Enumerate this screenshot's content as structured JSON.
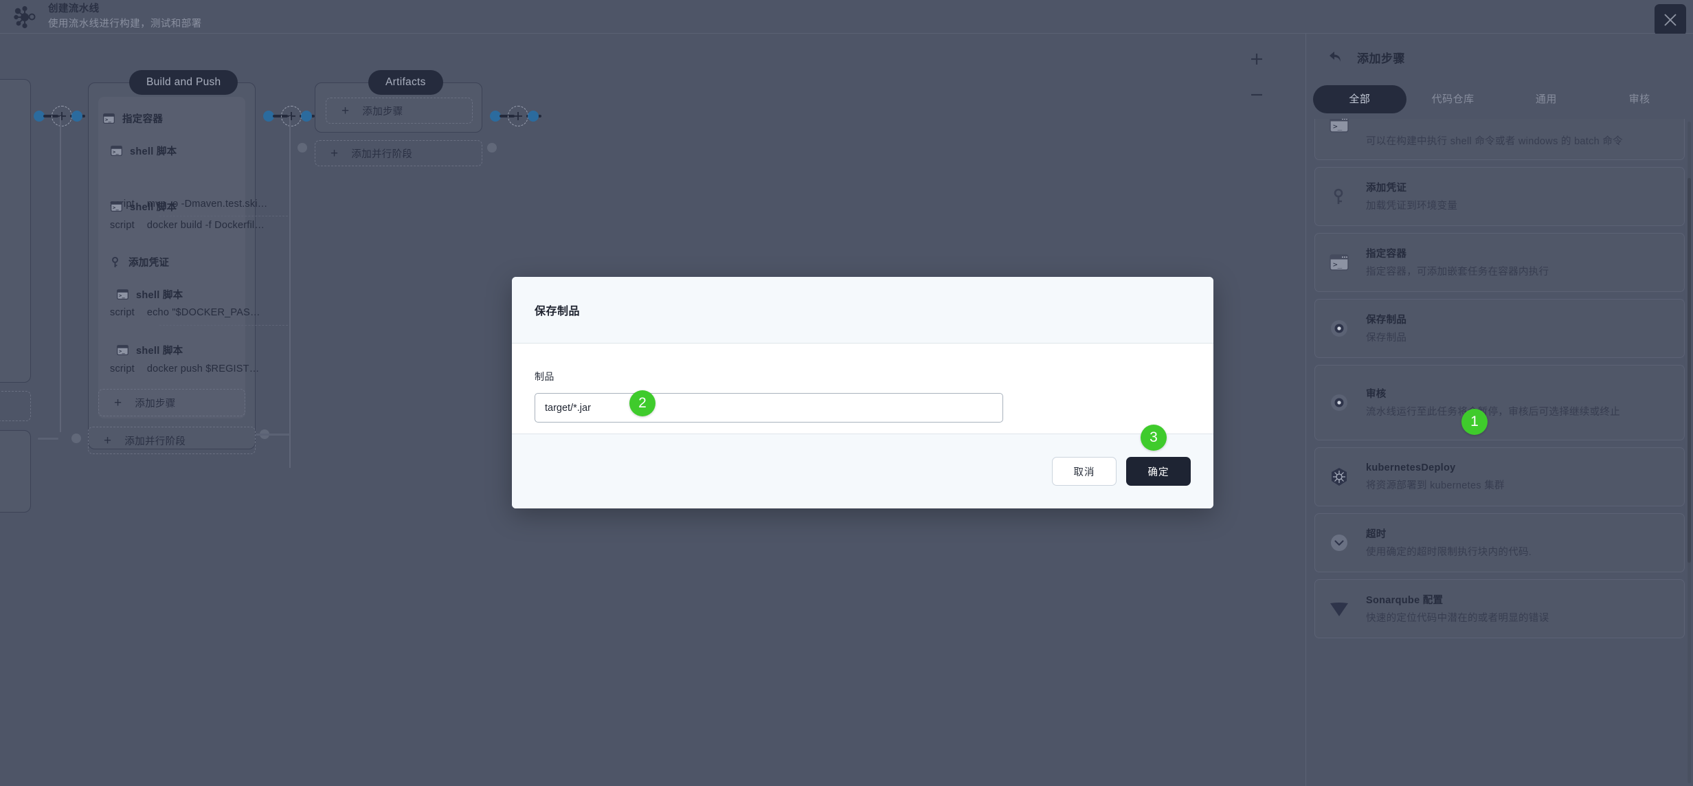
{
  "header": {
    "logo_icon": "pipeline-node-icon",
    "title": "创建流水线",
    "subtitle": "使用流水线进行构建，测试和部署",
    "close_icon": "close-icon"
  },
  "canvas": {
    "zoom_in_label": "+",
    "zoom_out_label": "−",
    "add_step_label": "添加步骤",
    "add_parallel_stage_label": "添加并行阶段",
    "stages": [
      {
        "name": "Build and Push",
        "steps": [
          {
            "icon": "terminal-icon",
            "title": "指定容器"
          },
          {
            "icon": "terminal-icon",
            "title": "shell 脚本",
            "script_key": "script",
            "script_value": "mvn -o -Dmaven.test.ski…"
          },
          {
            "icon": "terminal-icon",
            "title": "shell 脚本",
            "script_key": "script",
            "script_value": "docker build -f Dockerfil…"
          },
          {
            "icon": "key-icon",
            "title": "添加凭证"
          },
          {
            "icon": "terminal-icon",
            "title": "shell 脚本",
            "script_key": "script",
            "script_value": "echo \"$DOCKER_PAS…"
          },
          {
            "icon": "terminal-icon",
            "title": "shell 脚本",
            "script_key": "script",
            "script_value": "docker push $REGIST…"
          }
        ]
      },
      {
        "name": "Artifacts",
        "steps": []
      }
    ]
  },
  "sidebar": {
    "back_icon": "back-arrow-icon",
    "title": "添加步骤",
    "tabs": [
      {
        "label": "全部",
        "active": true
      },
      {
        "label": "代码仓库",
        "active": false
      },
      {
        "label": "通用",
        "active": false
      },
      {
        "label": "审核",
        "active": false
      }
    ],
    "items": [
      {
        "icon": "terminal-icon",
        "name": "",
        "desc": "可以在构建中执行 shell 命令或者 windows 的 batch 命令"
      },
      {
        "icon": "key-icon",
        "name": "添加凭证",
        "desc": "加载凭证到环境变量"
      },
      {
        "icon": "terminal-icon",
        "name": "指定容器",
        "desc": "指定容器，可添加嵌套任务在容器内执行"
      },
      {
        "icon": "disc-icon",
        "name": "保存制品",
        "desc": "保存制品"
      },
      {
        "icon": "disc-icon",
        "name": "审核",
        "desc": "流水线运行至此任务将会暂停，审核后可选择继续或终止"
      },
      {
        "icon": "kubernetes-icon",
        "name": "kubernetesDeploy",
        "desc": "将资源部署到 kubernetes 集群"
      },
      {
        "icon": "chevron-down-circle-icon",
        "name": "超时",
        "desc": "使用确定的超时限制执行块内的代码."
      },
      {
        "icon": "sonarqube-icon",
        "name": "Sonarqube 配置",
        "desc": "快速的定位代码中潜在的或者明显的错误"
      }
    ]
  },
  "modal": {
    "title": "保存制品",
    "field_label": "制品",
    "field_value": "target/*.jar",
    "field_placeholder": "",
    "cancel_label": "取消",
    "confirm_label": "确定"
  },
  "badges": [
    {
      "num": "1",
      "target": "sidebar-item-save-artifact"
    },
    {
      "num": "2",
      "target": "artifact-input"
    },
    {
      "num": "3",
      "target": "confirm-button"
    }
  ],
  "colors": {
    "badge_green": "#3fcb2c",
    "accent_dark": "#252b3d",
    "connector_blue": "#2b6b9e",
    "app_bg": "#4e5567"
  }
}
